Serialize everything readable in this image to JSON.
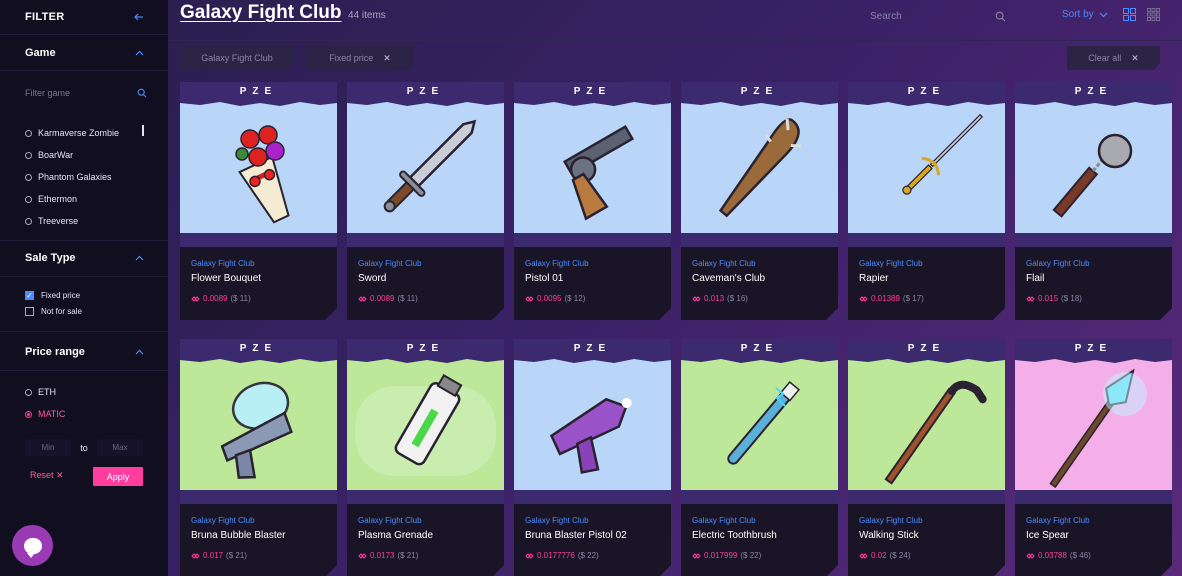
{
  "sidebar": {
    "title": "FILTER",
    "game_section": "Game",
    "filter_placeholder": "Filter game",
    "games": [
      "Karmaverse Zombie",
      "BoarWar",
      "Phantom Galaxies",
      "Ethermon",
      "Treeverse"
    ],
    "sale_type_section": "Sale Type",
    "sale_types": [
      {
        "label": "Fixed price",
        "checked": true
      },
      {
        "label": "Not for sale",
        "checked": false
      }
    ],
    "price_range_section": "Price range",
    "currencies": [
      {
        "label": "ETH",
        "selected": false
      },
      {
        "label": "MATIC",
        "selected": true
      }
    ],
    "min_placeholder": "Min",
    "to_label": "to",
    "max_placeholder": "Max",
    "reset_label": "Reset",
    "apply_label": "Apply"
  },
  "header": {
    "title": "Galaxy Fight Club",
    "count": "44 items",
    "search_placeholder": "Search",
    "sort_label": "Sort by"
  },
  "chips": [
    {
      "label": "Galaxy Fight Club",
      "removable": false
    },
    {
      "label": "Fixed price",
      "removable": true
    }
  ],
  "clear_all_label": "Clear all",
  "card_badge": "PZE",
  "cards": [
    {
      "game": "Galaxy Fight Club",
      "name": "Flower Bouquet",
      "eth": "0.0089",
      "usd": "($ 11)",
      "bg": "#b9d5f7",
      "art": "bouquet"
    },
    {
      "game": "Galaxy Fight Club",
      "name": "Sword",
      "eth": "0.0089",
      "usd": "($ 11)",
      "bg": "#b9d5f7",
      "art": "sword"
    },
    {
      "game": "Galaxy Fight Club",
      "name": "Pistol 01",
      "eth": "0.0095",
      "usd": "($ 12)",
      "bg": "#b9d5f7",
      "art": "pistol"
    },
    {
      "game": "Galaxy Fight Club",
      "name": "Caveman's Club",
      "eth": "0.013",
      "usd": "($ 16)",
      "bg": "#b9d5f7",
      "art": "club"
    },
    {
      "game": "Galaxy Fight Club",
      "name": "Rapier",
      "eth": "0.01389",
      "usd": "($ 17)",
      "bg": "#b9d5f7",
      "art": "rapier"
    },
    {
      "game": "Galaxy Fight Club",
      "name": "Flail",
      "eth": "0.015",
      "usd": "($ 18)",
      "bg": "#b9d5f7",
      "art": "flail"
    },
    {
      "game": "Galaxy Fight Club",
      "name": "Bruna Bubble Blaster",
      "eth": "0.017",
      "usd": "($ 21)",
      "bg": "#bde89a",
      "art": "blaster"
    },
    {
      "game": "Galaxy Fight Club",
      "name": "Plasma Grenade",
      "eth": "0.0173",
      "usd": "($ 21)",
      "bg": "#bde89a",
      "art": "grenade"
    },
    {
      "game": "Galaxy Fight Club",
      "name": "Bruna Blaster Pistol 02",
      "eth": "0.0177776",
      "usd": "($ 22)",
      "bg": "#b9d5f7",
      "art": "raygun"
    },
    {
      "game": "Galaxy Fight Club",
      "name": "Electric Toothbrush",
      "eth": "0.017999",
      "usd": "($ 22)",
      "bg": "#bde89a",
      "art": "toothbrush"
    },
    {
      "game": "Galaxy Fight Club",
      "name": "Walking Stick",
      "eth": "0.02",
      "usd": "($ 24)",
      "bg": "#bde89a",
      "art": "cane"
    },
    {
      "game": "Galaxy Fight Club",
      "name": "Ice Spear",
      "eth": "0.03788",
      "usd": "($ 46)",
      "bg": "#f4aee8",
      "art": "spear"
    }
  ],
  "colors": {
    "accent": "#ff3d9e",
    "link": "#4a8cff",
    "sidebar_bg": "#110e1f"
  }
}
